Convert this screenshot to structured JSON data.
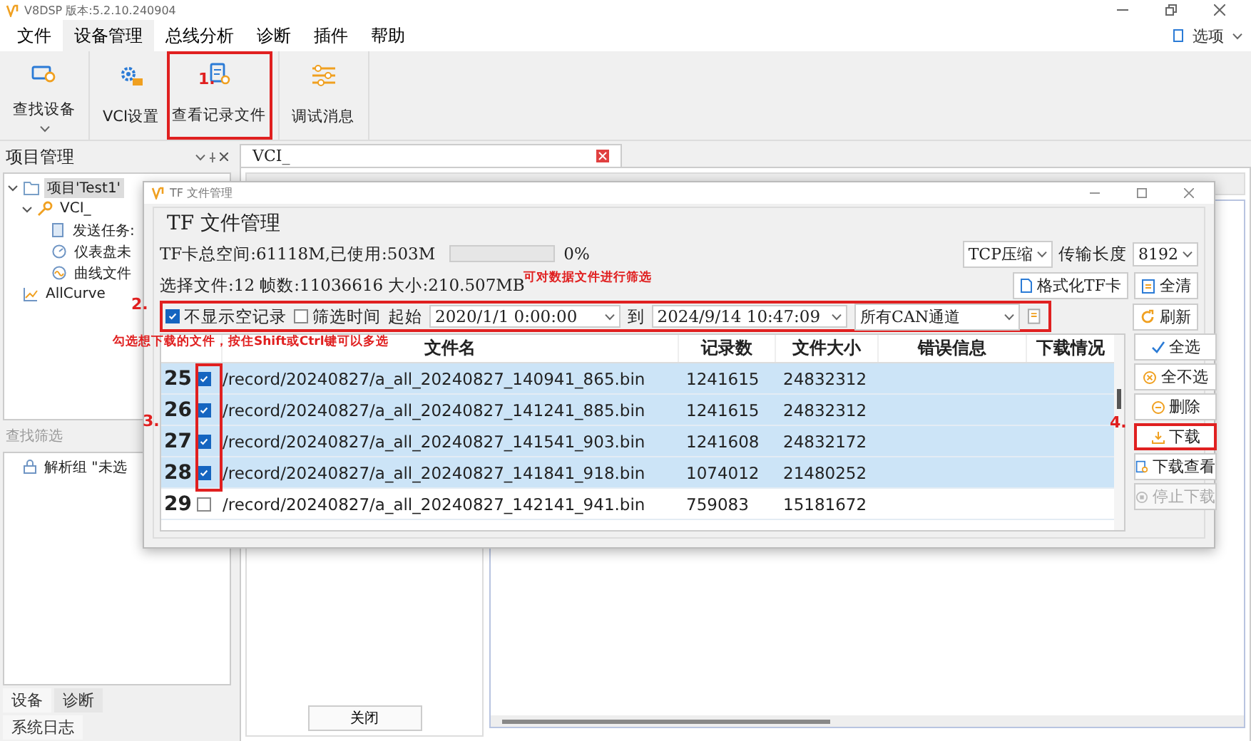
{
  "app_window": {
    "title": "V8DSP 版本:5.2.10.240904"
  },
  "menu": [
    {
      "label": "文件",
      "selected": false
    },
    {
      "label": "设备管理",
      "selected": true
    },
    {
      "label": "总线分析",
      "selected": false
    },
    {
      "label": "诊断",
      "selected": false
    },
    {
      "label": "插件",
      "selected": false
    },
    {
      "label": "帮助",
      "selected": false
    }
  ],
  "options_label": "选项",
  "ribbon": [
    {
      "label": "查找设备",
      "kind": "find",
      "highlighted": false
    },
    {
      "label": "VCI设置",
      "kind": "vci",
      "highlighted": false
    },
    {
      "label": "查看记录文件",
      "kind": "record",
      "highlighted": true
    },
    {
      "label": "调试消息",
      "kind": "debug",
      "highlighted": false
    }
  ],
  "project_panel": {
    "title": "项目管理",
    "tree": [
      {
        "label": "项目'Test1'",
        "kind": "project",
        "selected": true,
        "expanded": true,
        "children": [
          {
            "label": "VCI_",
            "kind": "device",
            "selected": false,
            "expanded": true,
            "children": [
              {
                "label": "发送任务:",
                "kind": "task",
                "selected": false
              },
              {
                "label": "仪表盘未",
                "kind": "dashboard",
                "selected": false
              },
              {
                "label": "曲线文件",
                "kind": "curve",
                "selected": false
              }
            ]
          }
        ]
      },
      {
        "label": "AllCurve",
        "kind": "chart",
        "selected": false
      }
    ]
  },
  "filter_panel": {
    "title": "查找筛选",
    "tree": [
      {
        "label": "解析组 \"未选",
        "kind": "group",
        "selected": false
      }
    ]
  },
  "bottom_tabs": [
    {
      "label": "设备",
      "selected": true
    },
    {
      "label": "诊断",
      "selected": false
    }
  ],
  "log_tab": {
    "label": "系统日志"
  },
  "document_tab": {
    "label": "VCI_"
  },
  "close_button": "关闭",
  "dialog": {
    "title": "TF 文件管理",
    "group_title": "TF  文件管理",
    "space_text": "TF卡总空间:61118M,已使用:503M",
    "usage": {
      "level": 0,
      "reading": "0%"
    },
    "compression": "TCP压缩",
    "length_label": "传输长度",
    "length": "8192",
    "selection_text": "选择文件:12 帧数:11036616 大小:210.507MB",
    "filter": {
      "highlighted": true,
      "hide_empty": {
        "label": "不显示空记录",
        "checked": true
      },
      "filter_time": {
        "label": "筛选时间",
        "checked": false
      },
      "start_label": "起始",
      "start": "2020/1/1 0:00:00",
      "to_label": "到",
      "end": "2024/9/14 10:47:09",
      "channel": "所有CAN通道"
    },
    "top_buttons": [
      {
        "label": "格式化TF卡",
        "kind": "format"
      },
      {
        "label": "全清",
        "kind": "clear"
      },
      {
        "label": "刷新",
        "kind": "refresh"
      }
    ],
    "table": {
      "checkbox_column_highlighted": true,
      "columns": [
        "文件名",
        "记录数",
        "文件大小",
        "错误信息",
        "下载情况"
      ],
      "rows": [
        {
          "index": "25",
          "checked": true,
          "selected": true,
          "name": "/record/20240827/a_all_20240827_140941_865.bin",
          "records": "1241615",
          "size": "24832312"
        },
        {
          "index": "26",
          "checked": true,
          "selected": true,
          "name": "/record/20240827/a_all_20240827_141241_885.bin",
          "records": "1241615",
          "size": "24832312"
        },
        {
          "index": "27",
          "checked": true,
          "selected": true,
          "name": "/record/20240827/a_all_20240827_141541_903.bin",
          "records": "1241608",
          "size": "24832172"
        },
        {
          "index": "28",
          "checked": true,
          "selected": true,
          "name": "/record/20240827/a_all_20240827_141841_918.bin",
          "records": "1074012",
          "size": "21480252"
        },
        {
          "index": "29",
          "checked": false,
          "selected": false,
          "name": "/record/20240827/a_all_20240827_142141_941.bin",
          "records": "759083",
          "size": "15181672"
        }
      ]
    },
    "side_buttons": [
      {
        "label": "全选",
        "kind": "check",
        "disabled": false,
        "highlighted": false
      },
      {
        "label": "全不选",
        "kind": "uncheck",
        "disabled": false,
        "highlighted": false
      },
      {
        "label": "删除",
        "kind": "delete",
        "disabled": false,
        "highlighted": false
      },
      {
        "label": "下载",
        "kind": "download",
        "disabled": false,
        "highlighted": true
      },
      {
        "label": "下载查看",
        "kind": "view",
        "disabled": false,
        "highlighted": false
      },
      {
        "label": "停止下载",
        "kind": "stop",
        "disabled": true,
        "highlighted": false
      }
    ]
  },
  "annotations": [
    {
      "text": "1."
    },
    {
      "text": "2."
    },
    {
      "text": "3."
    },
    {
      "text": "4."
    },
    {
      "text": "勾选想下载的文件，按住Shift或Ctrl键可以多选"
    },
    {
      "text": "可对数据文件进行筛选"
    }
  ]
}
